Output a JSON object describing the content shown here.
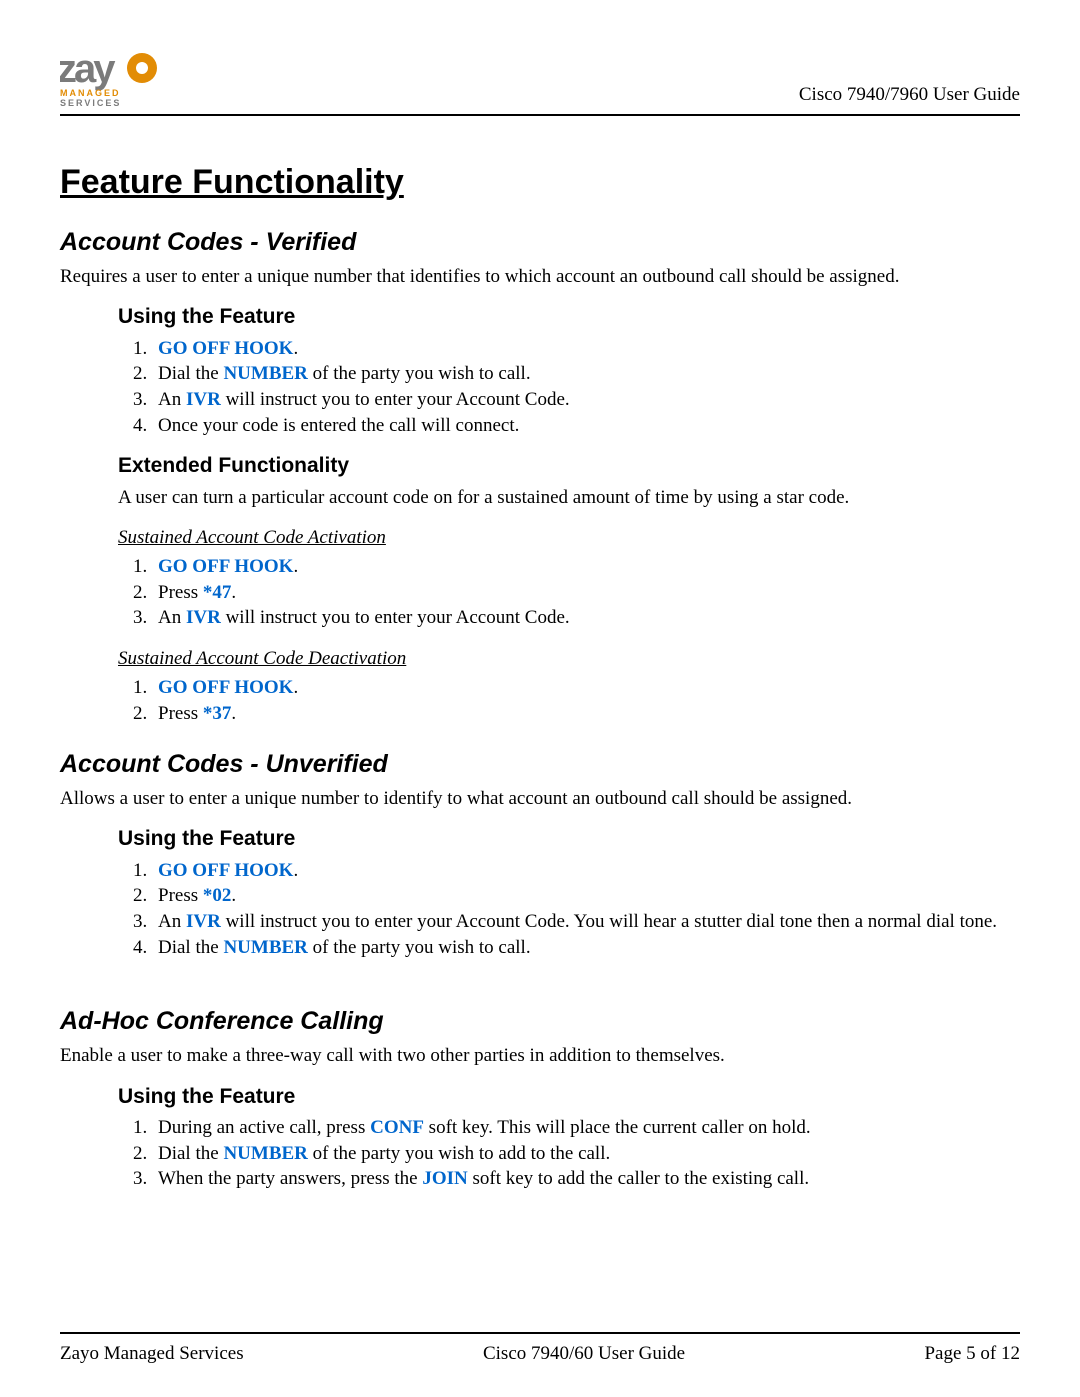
{
  "header": {
    "doc_title": "Cisco 7940/7960 User Guide",
    "logo": {
      "word": "zayo",
      "tag1": "MANAGED",
      "tag2": "SERVICES"
    }
  },
  "title": "Feature Functionality",
  "sections": {
    "verified": {
      "heading": "Account Codes - Verified",
      "desc": "Requires a user to enter a unique number that identifies to which account an outbound call should be assigned.",
      "using": {
        "heading": "Using the Feature",
        "steps": [
          [
            {
              "kw": "GO OFF HOOK"
            },
            "."
          ],
          [
            "Dial the ",
            {
              "kw": "NUMBER"
            },
            " of the party you wish to call."
          ],
          [
            "An ",
            {
              "kw": "IVR"
            },
            " will instruct you to enter your Account Code."
          ],
          [
            "Once your code is entered the call will connect."
          ]
        ]
      },
      "extended": {
        "heading": "Extended Functionality",
        "desc": "A user can turn a particular account code on for a sustained amount of time by using a star code.",
        "activation": {
          "heading": "Sustained Account Code Activation",
          "steps": [
            [
              {
                "kw": "GO OFF HOOK"
              },
              "."
            ],
            [
              "Press ",
              {
                "kw": "*47"
              },
              "."
            ],
            [
              "An ",
              {
                "kw": "IVR"
              },
              " will instruct you to enter your Account Code."
            ]
          ]
        },
        "deactivation": {
          "heading": "Sustained Account Code Deactivation",
          "steps": [
            [
              {
                "kw": "GO OFF HOOK"
              },
              "."
            ],
            [
              "Press ",
              {
                "kw": "*37"
              },
              "."
            ]
          ]
        }
      }
    },
    "unverified": {
      "heading": "Account Codes - Unverified",
      "desc": "Allows a user to enter a unique number to identify to what account an outbound call should be assigned.",
      "using": {
        "heading": "Using the Feature",
        "steps": [
          [
            {
              "kw": "GO OFF HOOK"
            },
            "."
          ],
          [
            "Press ",
            {
              "kw": "*02"
            },
            "."
          ],
          [
            "An ",
            {
              "kw": "IVR"
            },
            " will instruct you to enter your Account Code. You will hear a stutter dial tone then a normal dial tone."
          ],
          [
            "Dial the ",
            {
              "kw": "NUMBER"
            },
            " of the party you wish to call."
          ]
        ]
      }
    },
    "adhoc": {
      "heading": "Ad-Hoc Conference Calling",
      "desc": "Enable a user to make a three-way call with two other parties in addition to themselves.",
      "using": {
        "heading": "Using the Feature",
        "steps": [
          [
            "During an active call, press ",
            {
              "kw": "CONF"
            },
            " soft key.  This will place the current caller on hold."
          ],
          [
            "Dial the ",
            {
              "kw": "NUMBER"
            },
            " of the party you wish to add to the call."
          ],
          [
            "When the party answers, press the ",
            {
              "kw": "JOIN"
            },
            " soft key to add the caller to the existing call."
          ]
        ]
      }
    }
  },
  "footer": {
    "left": "Zayo Managed Services",
    "center": "Cisco 7940/60 User Guide",
    "right_prefix": "Page ",
    "page": "5",
    "of_word": " of ",
    "total": "12"
  }
}
